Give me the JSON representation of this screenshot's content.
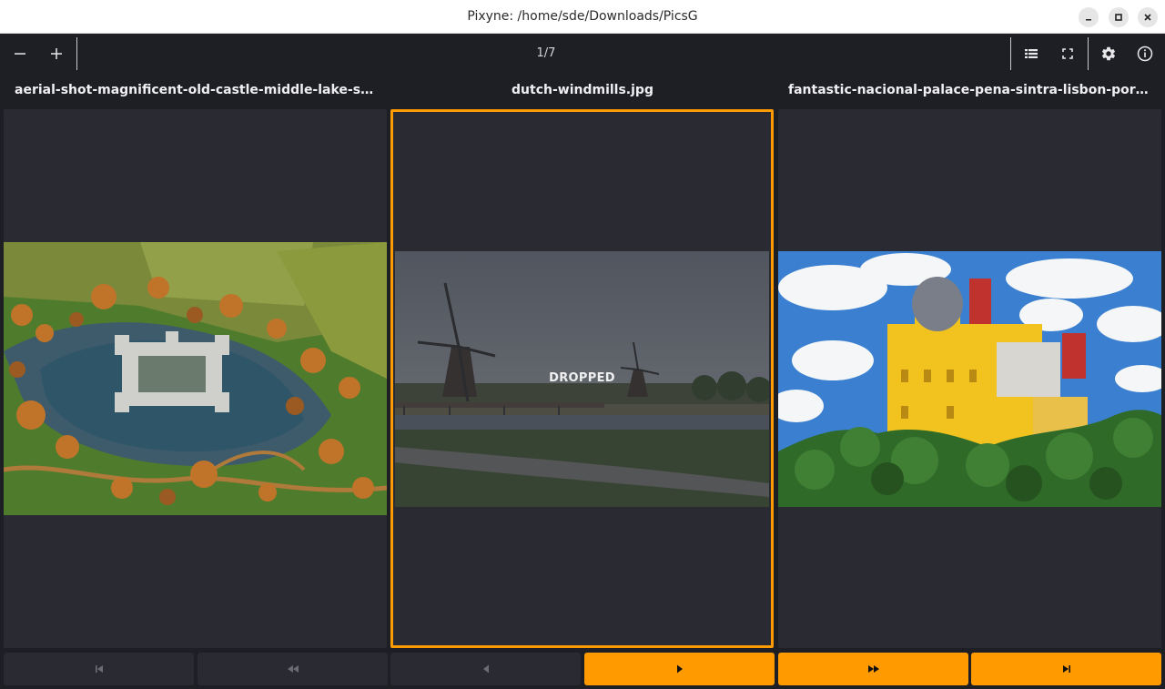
{
  "window": {
    "title": "Pixyne: /home/sde/Downloads/PicsG"
  },
  "toolbar": {
    "zoom_out_icon": "minus-icon",
    "zoom_in_icon": "plus-icon",
    "counter": "1/7",
    "list_icon": "list-icon",
    "fullscreen_icon": "fullscreen-icon",
    "settings_icon": "gear-icon",
    "info_icon": "info-icon"
  },
  "panels": [
    {
      "filename": "aerial-shot-magnificent-old-castle-middle-lake-surrounded-trees.jpg",
      "status": ""
    },
    {
      "filename": "dutch-windmills.jpg",
      "status": "DROPPED",
      "selected": true
    },
    {
      "filename": "fantastic-nacional-palace-pena-sintra-lisbon-portugal-with-blue-sky.jpg",
      "status": ""
    }
  ],
  "navigation": {
    "first_icon": "skip-first-icon",
    "rewind_icon": "fast-rewind-icon",
    "prev_icon": "prev-icon",
    "next_icon": "next-icon",
    "forward_icon": "fast-forward-icon",
    "last_icon": "skip-last-icon"
  },
  "colors": {
    "accent": "#ff9a00",
    "background": "#1e1f25",
    "panel": "#2a2b32"
  }
}
